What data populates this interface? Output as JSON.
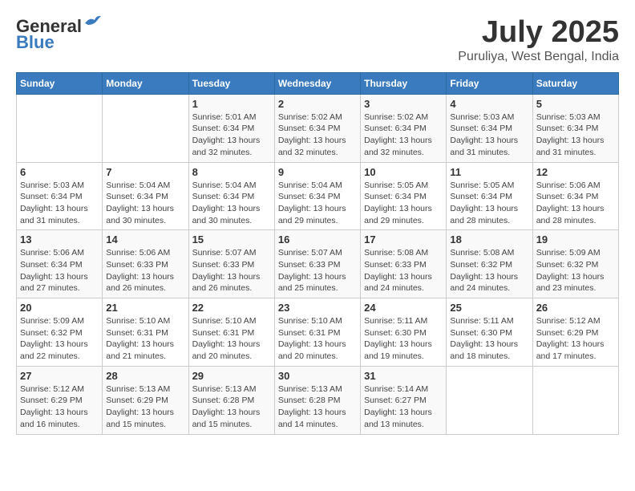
{
  "header": {
    "logo_general": "General",
    "logo_blue": "Blue",
    "month_year": "July 2025",
    "location": "Puruliya, West Bengal, India"
  },
  "weekdays": [
    "Sunday",
    "Monday",
    "Tuesday",
    "Wednesday",
    "Thursday",
    "Friday",
    "Saturday"
  ],
  "weeks": [
    [
      {
        "day": "",
        "info": ""
      },
      {
        "day": "",
        "info": ""
      },
      {
        "day": "1",
        "info": "Sunrise: 5:01 AM\nSunset: 6:34 PM\nDaylight: 13 hours\nand 32 minutes."
      },
      {
        "day": "2",
        "info": "Sunrise: 5:02 AM\nSunset: 6:34 PM\nDaylight: 13 hours\nand 32 minutes."
      },
      {
        "day": "3",
        "info": "Sunrise: 5:02 AM\nSunset: 6:34 PM\nDaylight: 13 hours\nand 32 minutes."
      },
      {
        "day": "4",
        "info": "Sunrise: 5:03 AM\nSunset: 6:34 PM\nDaylight: 13 hours\nand 31 minutes."
      },
      {
        "day": "5",
        "info": "Sunrise: 5:03 AM\nSunset: 6:34 PM\nDaylight: 13 hours\nand 31 minutes."
      }
    ],
    [
      {
        "day": "6",
        "info": "Sunrise: 5:03 AM\nSunset: 6:34 PM\nDaylight: 13 hours\nand 31 minutes."
      },
      {
        "day": "7",
        "info": "Sunrise: 5:04 AM\nSunset: 6:34 PM\nDaylight: 13 hours\nand 30 minutes."
      },
      {
        "day": "8",
        "info": "Sunrise: 5:04 AM\nSunset: 6:34 PM\nDaylight: 13 hours\nand 30 minutes."
      },
      {
        "day": "9",
        "info": "Sunrise: 5:04 AM\nSunset: 6:34 PM\nDaylight: 13 hours\nand 29 minutes."
      },
      {
        "day": "10",
        "info": "Sunrise: 5:05 AM\nSunset: 6:34 PM\nDaylight: 13 hours\nand 29 minutes."
      },
      {
        "day": "11",
        "info": "Sunrise: 5:05 AM\nSunset: 6:34 PM\nDaylight: 13 hours\nand 28 minutes."
      },
      {
        "day": "12",
        "info": "Sunrise: 5:06 AM\nSunset: 6:34 PM\nDaylight: 13 hours\nand 28 minutes."
      }
    ],
    [
      {
        "day": "13",
        "info": "Sunrise: 5:06 AM\nSunset: 6:34 PM\nDaylight: 13 hours\nand 27 minutes."
      },
      {
        "day": "14",
        "info": "Sunrise: 5:06 AM\nSunset: 6:33 PM\nDaylight: 13 hours\nand 26 minutes."
      },
      {
        "day": "15",
        "info": "Sunrise: 5:07 AM\nSunset: 6:33 PM\nDaylight: 13 hours\nand 26 minutes."
      },
      {
        "day": "16",
        "info": "Sunrise: 5:07 AM\nSunset: 6:33 PM\nDaylight: 13 hours\nand 25 minutes."
      },
      {
        "day": "17",
        "info": "Sunrise: 5:08 AM\nSunset: 6:33 PM\nDaylight: 13 hours\nand 24 minutes."
      },
      {
        "day": "18",
        "info": "Sunrise: 5:08 AM\nSunset: 6:32 PM\nDaylight: 13 hours\nand 24 minutes."
      },
      {
        "day": "19",
        "info": "Sunrise: 5:09 AM\nSunset: 6:32 PM\nDaylight: 13 hours\nand 23 minutes."
      }
    ],
    [
      {
        "day": "20",
        "info": "Sunrise: 5:09 AM\nSunset: 6:32 PM\nDaylight: 13 hours\nand 22 minutes."
      },
      {
        "day": "21",
        "info": "Sunrise: 5:10 AM\nSunset: 6:31 PM\nDaylight: 13 hours\nand 21 minutes."
      },
      {
        "day": "22",
        "info": "Sunrise: 5:10 AM\nSunset: 6:31 PM\nDaylight: 13 hours\nand 20 minutes."
      },
      {
        "day": "23",
        "info": "Sunrise: 5:10 AM\nSunset: 6:31 PM\nDaylight: 13 hours\nand 20 minutes."
      },
      {
        "day": "24",
        "info": "Sunrise: 5:11 AM\nSunset: 6:30 PM\nDaylight: 13 hours\nand 19 minutes."
      },
      {
        "day": "25",
        "info": "Sunrise: 5:11 AM\nSunset: 6:30 PM\nDaylight: 13 hours\nand 18 minutes."
      },
      {
        "day": "26",
        "info": "Sunrise: 5:12 AM\nSunset: 6:29 PM\nDaylight: 13 hours\nand 17 minutes."
      }
    ],
    [
      {
        "day": "27",
        "info": "Sunrise: 5:12 AM\nSunset: 6:29 PM\nDaylight: 13 hours\nand 16 minutes."
      },
      {
        "day": "28",
        "info": "Sunrise: 5:13 AM\nSunset: 6:29 PM\nDaylight: 13 hours\nand 15 minutes."
      },
      {
        "day": "29",
        "info": "Sunrise: 5:13 AM\nSunset: 6:28 PM\nDaylight: 13 hours\nand 15 minutes."
      },
      {
        "day": "30",
        "info": "Sunrise: 5:13 AM\nSunset: 6:28 PM\nDaylight: 13 hours\nand 14 minutes."
      },
      {
        "day": "31",
        "info": "Sunrise: 5:14 AM\nSunset: 6:27 PM\nDaylight: 13 hours\nand 13 minutes."
      },
      {
        "day": "",
        "info": ""
      },
      {
        "day": "",
        "info": ""
      }
    ]
  ]
}
